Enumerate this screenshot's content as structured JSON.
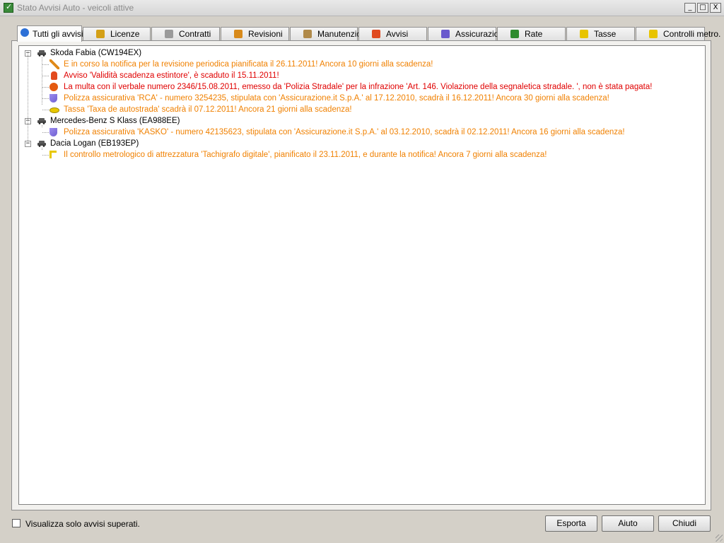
{
  "window": {
    "title": "Stato Avvisi Auto - veicoli attive",
    "controls": {
      "minimize": "_",
      "maximize": "□",
      "close": "X"
    }
  },
  "tabs": [
    {
      "label": "Tutti gli avvisi",
      "icon": "info-icon",
      "active": true
    },
    {
      "label": "Licenze",
      "icon": "license-icon"
    },
    {
      "label": "Contratti",
      "icon": "contract-icon"
    },
    {
      "label": "Revisioni",
      "icon": "wrench-icon"
    },
    {
      "label": "Manutenzioni",
      "icon": "tools-icon"
    },
    {
      "label": "Avvisi",
      "icon": "fire-extinguisher-icon"
    },
    {
      "label": "Assicurazioni",
      "icon": "shield-icon"
    },
    {
      "label": "Rate",
      "icon": "euro-icon"
    },
    {
      "label": "Tasse",
      "icon": "coins-icon"
    },
    {
      "label": "Controlli metro.",
      "icon": "tachograph-icon"
    }
  ],
  "tree": {
    "vehicles": [
      {
        "name": "Skoda Fabia (CW194EX)",
        "expand": "−",
        "notices": [
          {
            "text": "E in corso la notifica per la revisione periodica pianificata il 26.11.2011! Ancora 10 giorni alla scadenza!",
            "color": "#f08000",
            "icon": "wrench-icon"
          },
          {
            "text": "Avviso 'Validità scadenza estintore',  è scaduto il 15.11.2011!",
            "color": "#e00000",
            "icon": "fire-extinguisher-icon"
          },
          {
            "text": "La multa con il verbale numero 2346/15.08.2011, emesso da 'Polizia Stradale' per la infrazione 'Art. 146. Violazione della segnaletica stradale. ', non è stata pagata!",
            "color": "#e00000",
            "icon": "fine-icon"
          },
          {
            "text": "Polizza assicurativa 'RCA' - numero 3254235, stipulata con 'Assicurazione.it S.p.A.' al 17.12.2010,  scadrà il 16.12.2011! Ancora 30 giorni alla scadenza!",
            "color": "#f08000",
            "icon": "shield-icon"
          },
          {
            "text": "Tassa 'Taxa de autostrada' scadrà il 07.12.2011! Ancora 21 giorni alla scadenza!",
            "color": "#f08000",
            "icon": "coins-icon"
          }
        ]
      },
      {
        "name": "Mercedes-Benz S Klass (EA988EE)",
        "expand": "−",
        "notices": [
          {
            "text": "Polizza assicurativa 'KASKO' - numero 42135623, stipulata con 'Assicurazione.it S.p.A.' al 03.12.2010,  scadrà il 02.12.2011! Ancora 16 giorni alla scadenza!",
            "color": "#f08000",
            "icon": "shield-icon"
          }
        ]
      },
      {
        "name": "Dacia Logan (EB193EP)",
        "expand": "−",
        "notices": [
          {
            "text": "Il controllo metrologico di attrezzatura 'Tachigrafo digitale', pianificato il 23.11.2011, e durante la notifica! Ancora 7 giorni alla scadenza!",
            "color": "#f08000",
            "icon": "tachograph-icon"
          }
        ]
      }
    ]
  },
  "footer": {
    "checkbox_label": "Visualizza solo avvisi superati.",
    "checked": false,
    "buttons": {
      "export": "Esporta",
      "help": "Aiuto",
      "close": "Chiudi"
    }
  }
}
